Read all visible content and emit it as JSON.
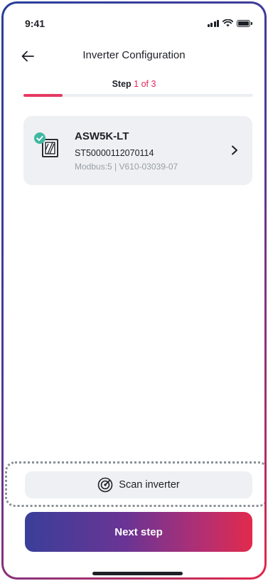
{
  "status_bar": {
    "time": "9:41",
    "icons": [
      "signal-icon",
      "wifi-icon",
      "battery-icon"
    ]
  },
  "header": {
    "title": "Inverter Configuration",
    "back_icon": "arrow-left-icon"
  },
  "step": {
    "label": "Step",
    "count": "1 of 3",
    "current": 1,
    "total": 3,
    "progress_fraction": 0.17
  },
  "inverter": {
    "model": "ASW5K-LT",
    "serial": "ST50000112070114",
    "meta": "Modbus:5 | V610-03039-07",
    "status_icon": "check-circle-icon",
    "device_icon": "inverter-device-icon",
    "chevron_icon": "chevron-right-icon"
  },
  "actions": {
    "scan_label": "Scan inverter",
    "scan_icon": "radar-scan-icon",
    "next_label": "Next step"
  },
  "colors": {
    "accent": "#e2285a",
    "status_ok": "#3fb8a0",
    "card_bg": "#eef0f3",
    "gradient_start": "#3a3f9a",
    "gradient_end": "#e22a4c"
  }
}
